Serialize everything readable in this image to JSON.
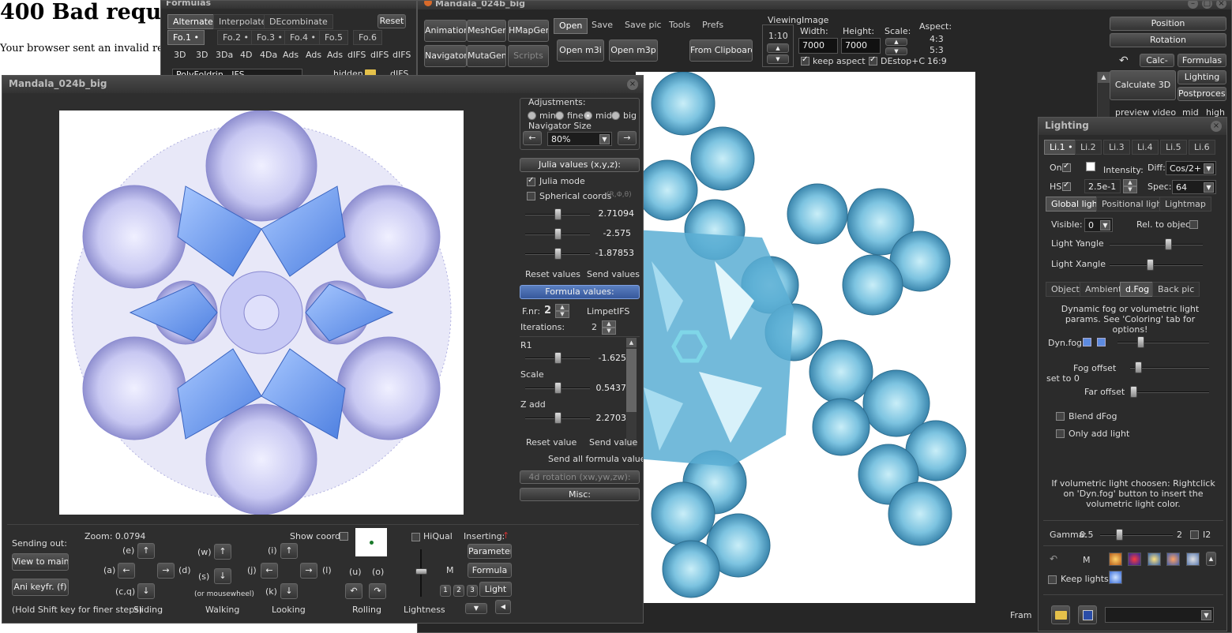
{
  "browser": {
    "heading": "400 Bad reques",
    "message": "Your browser sent an invalid rec"
  },
  "formulas": {
    "title": "Formulas",
    "top_tabs": [
      "Alternate",
      "Interpolate",
      "DEcombinate"
    ],
    "reset": "Reset",
    "formula_tabs": [
      "Fo.1 •",
      "Fo.2 •",
      "Fo.3 •",
      "Fo.4 •",
      "Fo.5",
      "Fo.6"
    ],
    "type_tabs": [
      "3D",
      "3D",
      "3Da",
      "4D",
      "4Da",
      "Ads",
      "Ads",
      "Ads",
      "dIFS",
      "dIFS",
      "dIFS"
    ],
    "row3_left": "PolyFoldrin...IFS",
    "row3_hidden": "hidden",
    "row3_right": "dIFS"
  },
  "main": {
    "title": "Mandala_024b_big",
    "buttons": {
      "animations": "Animations",
      "meshgen": "MeshGen",
      "hmapgen": "HMapGen",
      "navigator": "Navigator",
      "mutagen": "MutaGen",
      "scripts": "Scripts",
      "open": "Open",
      "save": "Save",
      "save_pic": "Save pic",
      "tools": "Tools",
      "prefs": "Prefs",
      "open_m3i": "Open m3i",
      "open_m3p": "Open m3p",
      "from_clipboard": "From Clipboard"
    },
    "viewing_label": "Viewing",
    "viewing_ratio": "1:10",
    "image_label": "Image",
    "width_label": "Width:",
    "width": "7000",
    "height_label": "Height:",
    "height": "7000",
    "scale_label": "Scale:",
    "aspect_label": "Aspect:",
    "aspects": [
      "4:3",
      "5:3",
      "16:9"
    ],
    "keep_aspect": "keep aspect",
    "destop": "DEstop+C",
    "status": "Fram"
  },
  "right_panel": {
    "position": "Position",
    "rotation": "Rotation",
    "calc_small": "Calc-",
    "formulas": "Formulas",
    "calculate_3d": "Calculate 3D",
    "lighting": "Lighting",
    "postprocess": "Postprocess",
    "quality": [
      "preview",
      "video",
      "mid",
      "high"
    ]
  },
  "navigator": {
    "title": "Mandala_024b_big",
    "adjustments_label": "Adjustments:",
    "adjust_options": [
      "min",
      "fine",
      "mid",
      "big"
    ],
    "adjust_selected": "mid",
    "nav_size_label": "Navigator Size",
    "nav_size": "80%",
    "julia_values": "Julia values (x,y,z):",
    "julia_mode": "Julia mode",
    "spherical": "Spherical coords",
    "spherical_hint": "(R,Φ,θ)",
    "julia_vals": [
      "2.71094",
      "-2.575",
      "-1.87853"
    ],
    "reset_values": "Reset values",
    "send_values": "Send values",
    "formula_values": "Formula values:",
    "fnr_label": "F.nr:",
    "fnr": "2",
    "formula_name": "LimpetIFS",
    "iterations_label": "Iterations:",
    "iterations": "2",
    "params": [
      {
        "name": "R1",
        "value": "-1.625"
      },
      {
        "name": "Scale",
        "value": "0.5437"
      },
      {
        "name": "Z add",
        "value": "2.2703"
      }
    ],
    "reset_value": "Reset value",
    "send_value": "Send value",
    "send_all": "Send all formula values",
    "rotation_4d": "4d rotation (xw,yw,zw):",
    "misc": "Misc:",
    "sending_out": "Sending out:",
    "view_to_main": "View to main",
    "ani_keyfr": "Ani keyfr. (f)",
    "hold_shift": "(Hold Shift key for finer steps)",
    "zoom": "Zoom: 0.0794",
    "show_coords": "Show coords",
    "keys": {
      "e": "(e)",
      "a": "(a)",
      "d": "(d)",
      "cq": "(c,q)",
      "w": "(w)",
      "s": "(s)",
      "i": "(i)",
      "j": "(j)",
      "l": "(l)",
      "k": "(k)",
      "u": "(u)",
      "o": "(o)"
    },
    "mousewheel": "(or mousewheel)",
    "groups": [
      "Sliding",
      "Walking",
      "Looking",
      "Rolling",
      "Lightness"
    ],
    "hiqual": "HiQual",
    "inserting": "Inserting:",
    "parameter": "Parameter",
    "formula": "Formula",
    "light": "Light",
    "m": "M",
    "nums": [
      "1",
      "2",
      "3"
    ]
  },
  "lighting": {
    "title": "Lighting",
    "light_tabs": [
      "Li.1 •",
      "Li.2",
      "Li.3",
      "Li.4",
      "Li.5",
      "Li.6"
    ],
    "on": "On",
    "intensity": "Intensity:",
    "diff_label": "Diff:",
    "diff": "Cos/2+",
    "hs": "HS",
    "hs_val": "2.5e-1",
    "spec_label": "Spec:",
    "spec": "64",
    "mode_tabs": [
      "Global light",
      "Positional light",
      "Lightmap"
    ],
    "visible_label": "Visible:",
    "visible": "0",
    "rel_obj": "Rel. to object:",
    "yangle": "Light Yangle",
    "xangle": "Light Xangle",
    "sub_tabs": [
      "Object",
      "Ambient",
      "d.Fog",
      "Back pic"
    ],
    "dfog_desc": "Dynamic fog or volumetric light params. See 'Coloring' tab for options!",
    "dynfog": "Dyn.fog",
    "fog_offset": "Fog offset",
    "set_to_0": "set to 0",
    "far_offset": "Far offset",
    "blend": "Blend dFog",
    "only_add": "Only add light",
    "vol_note": "If volumetric light choosen:  Rightclick on 'Dyn.fog' button to insert the volumetric light color.",
    "gamma_label": "Gamma:",
    "gamma": "0.5",
    "gamma_max": "2",
    "i2": "I2",
    "m": "M",
    "keep_lights": "Keep lights"
  },
  "colors": {
    "panel": "#2b2b2b",
    "accent_blue": "#4a6fb5",
    "fog_swatch": "#5d8be0"
  }
}
